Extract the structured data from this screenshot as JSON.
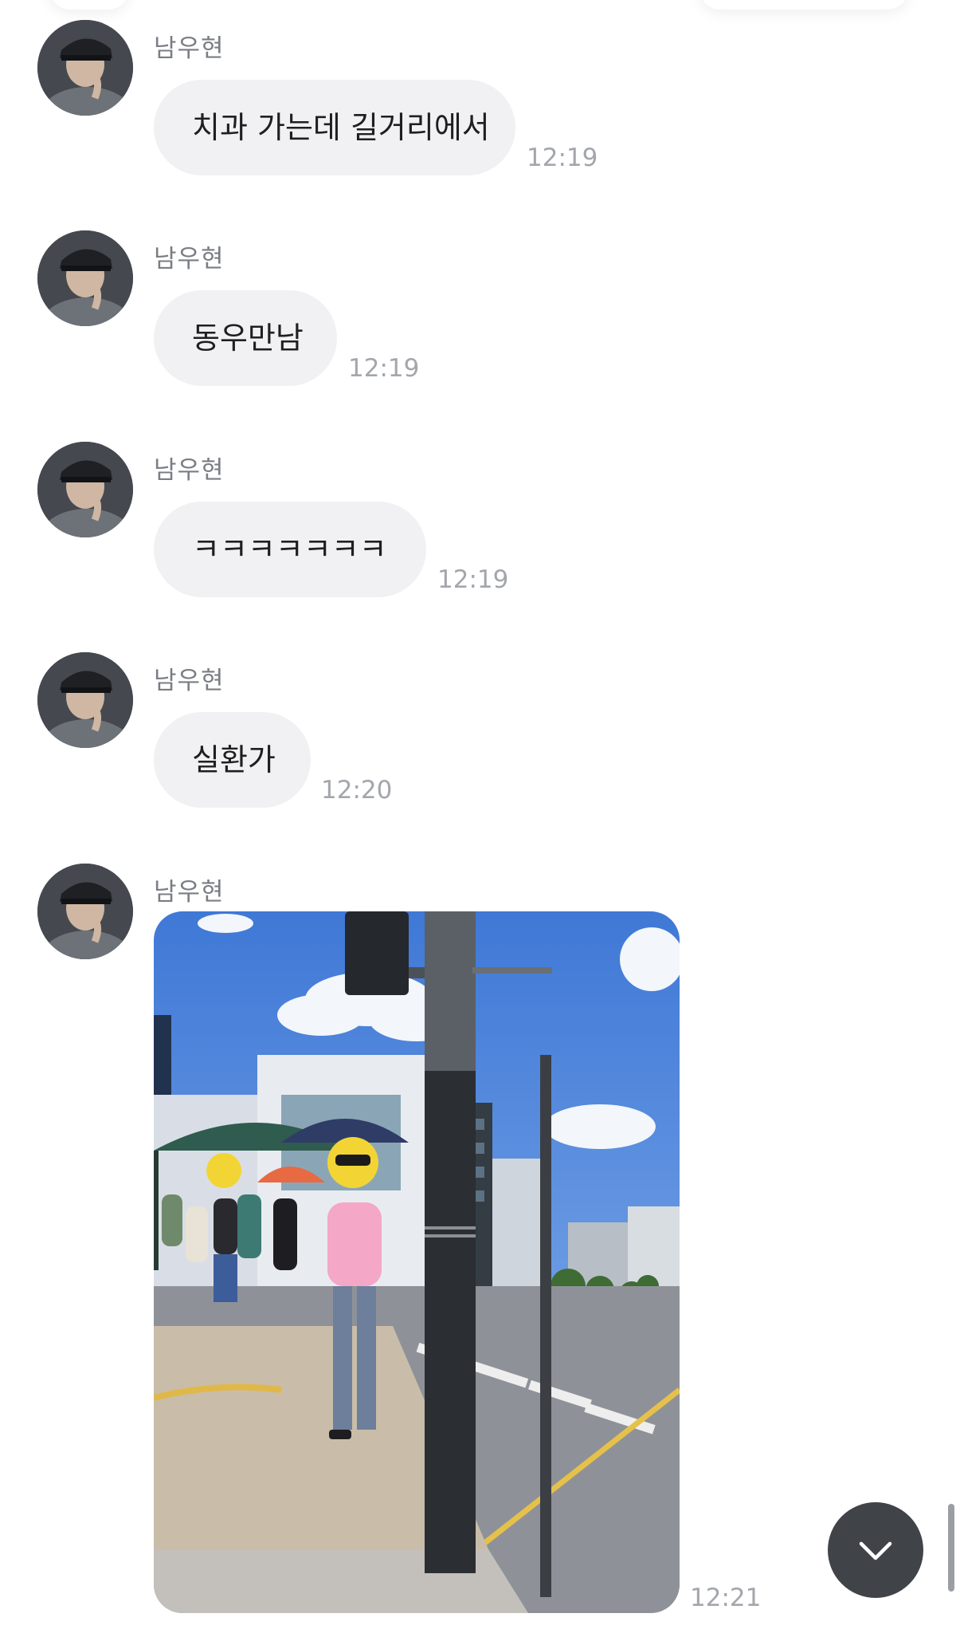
{
  "chat": {
    "messages": [
      {
        "sender": "남우현",
        "text": "치과 가는데 길거리에서",
        "time": "12:19"
      },
      {
        "sender": "남우현",
        "text": "동우만남",
        "time": "12:19"
      },
      {
        "sender": "남우현",
        "text": "ㅋㅋㅋㅋㅋㅋㅋ",
        "time": "12:19"
      },
      {
        "sender": "남우현",
        "text": "실환가",
        "time": "12:20"
      }
    ],
    "photo_message": {
      "sender": "남우현",
      "time": "12:21"
    }
  },
  "icons": {
    "scroll_down": "chevron-down-icon",
    "avatar": "profile-photo"
  },
  "colors": {
    "bubble": "#f1f1f3",
    "sender": "#7a7d83",
    "time": "#a3a6ac",
    "fab": "#404348"
  }
}
